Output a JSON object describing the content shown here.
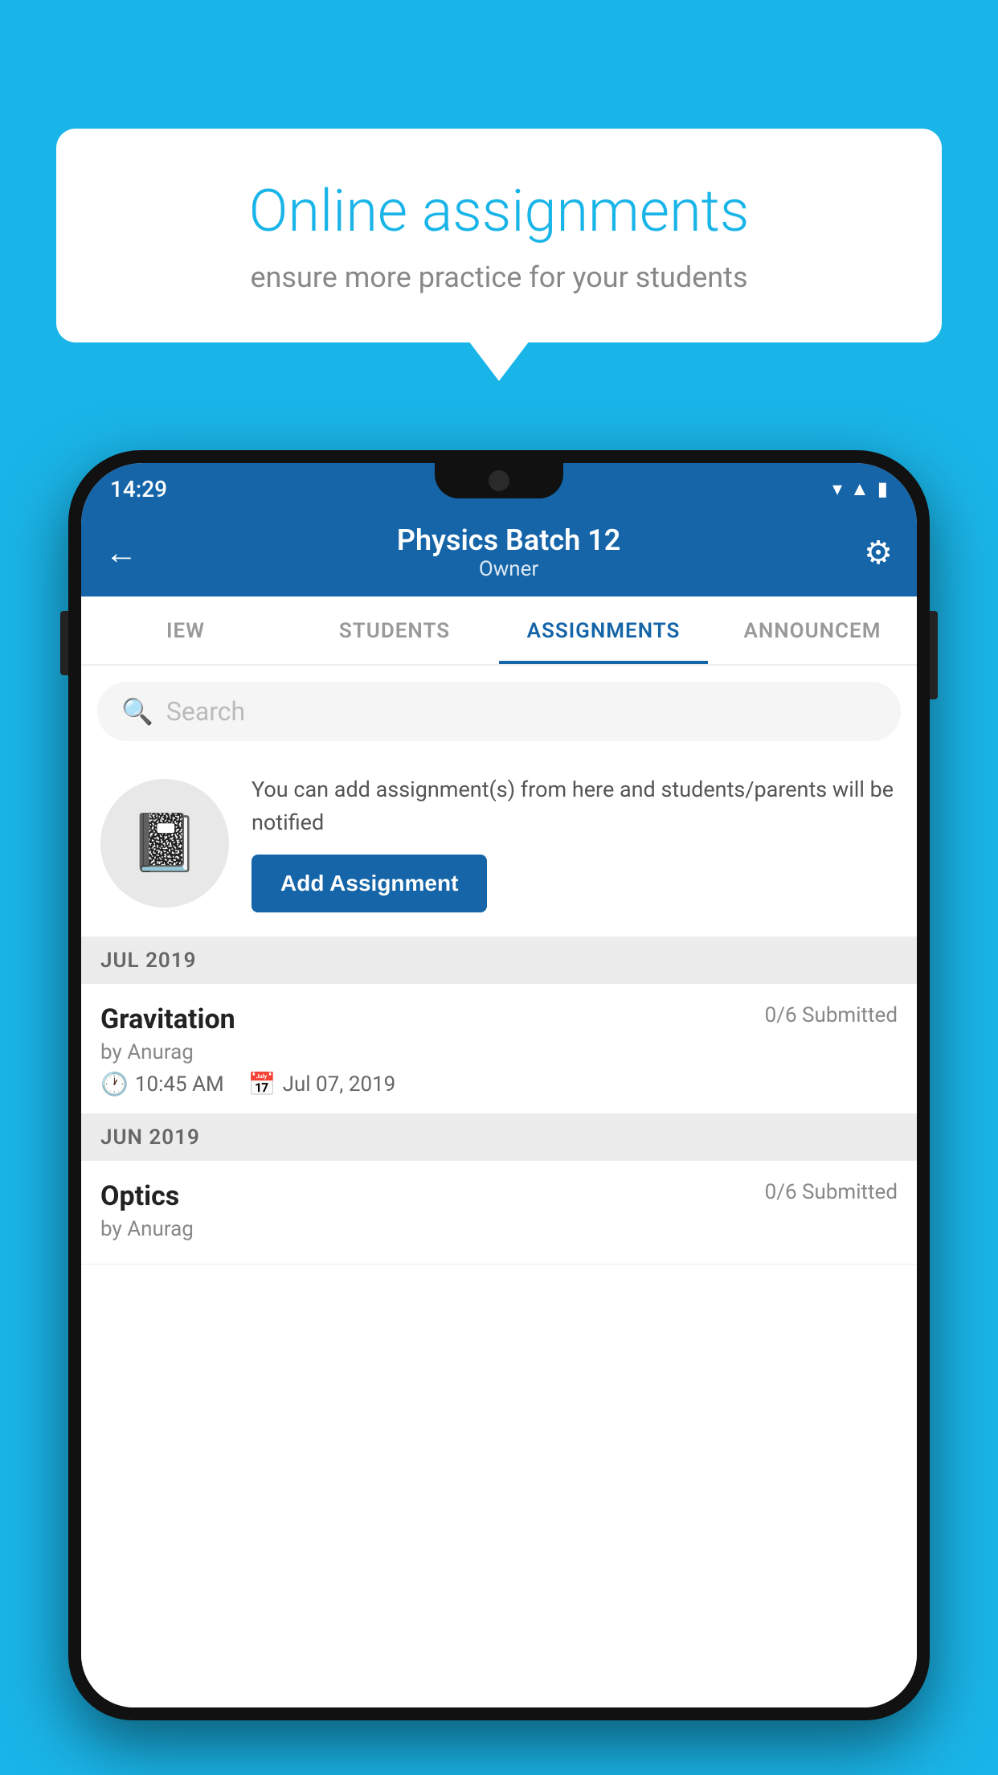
{
  "background_color": "#1ab5e8",
  "speech_bubble": {
    "title": "Online assignments",
    "subtitle": "ensure more practice for your students"
  },
  "status_bar": {
    "time": "14:29",
    "icons": [
      "wifi",
      "signal",
      "battery"
    ]
  },
  "app_bar": {
    "title": "Physics Batch 12",
    "subtitle": "Owner",
    "back_label": "←",
    "settings_label": "⚙"
  },
  "tabs": [
    {
      "label": "IEW",
      "active": false
    },
    {
      "label": "STUDENTS",
      "active": false
    },
    {
      "label": "ASSIGNMENTS",
      "active": true
    },
    {
      "label": "ANNOUNCEM",
      "active": false
    }
  ],
  "search": {
    "placeholder": "Search"
  },
  "promo": {
    "description": "You can add assignment(s) from here and students/parents will be notified",
    "button_label": "Add Assignment"
  },
  "sections": [
    {
      "header": "JUL 2019",
      "assignments": [
        {
          "title": "Gravitation",
          "submitted": "0/6 Submitted",
          "author": "by Anurag",
          "time": "10:45 AM",
          "date": "Jul 07, 2019"
        }
      ]
    },
    {
      "header": "JUN 2019",
      "assignments": [
        {
          "title": "Optics",
          "submitted": "0/6 Submitted",
          "author": "by Anurag",
          "time": "",
          "date": ""
        }
      ]
    }
  ]
}
